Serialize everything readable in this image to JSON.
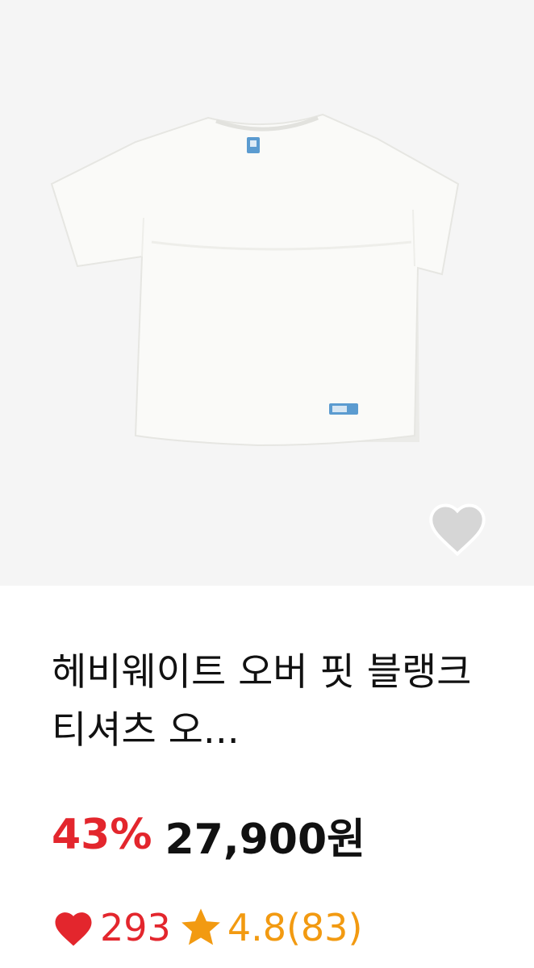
{
  "product": {
    "image_alt": "white t-shirt",
    "title": "헤비웨이트 오버 핏 블랭크 티셔츠 오...",
    "discount": "43%",
    "price": "27,900원",
    "likes": "293",
    "rating_text": "4.8(83)"
  },
  "icons": {
    "wish": "heart-outline-icon",
    "likes": "heart-icon",
    "rating": "star-icon"
  },
  "colors": {
    "discount": "#e3262d",
    "rating": "#f29a11",
    "image_bg": "#f5f5f5"
  }
}
